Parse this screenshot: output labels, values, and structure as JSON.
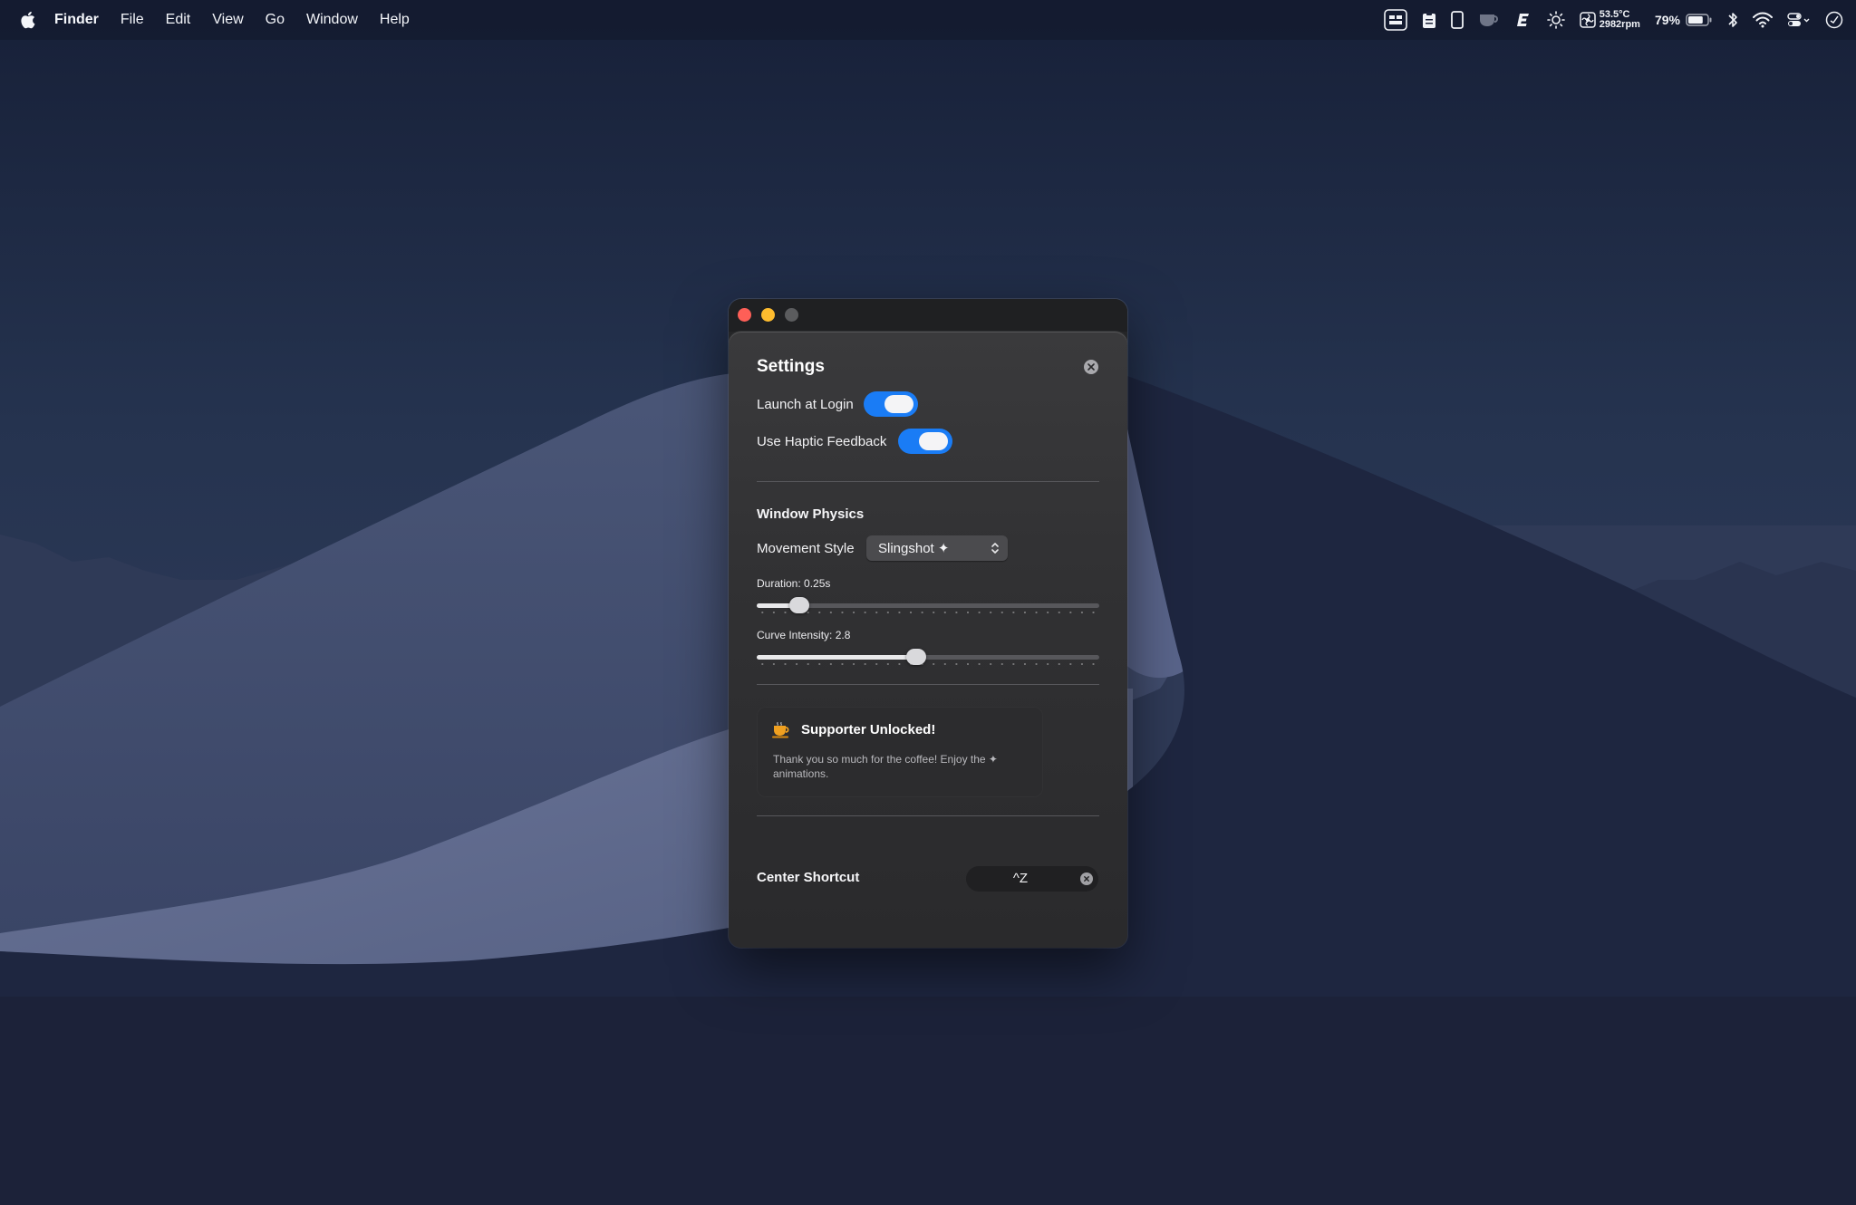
{
  "menubar": {
    "app_name": "Finder",
    "menus": [
      "File",
      "Edit",
      "View",
      "Go",
      "Window",
      "Help"
    ],
    "status": {
      "temperature": "53.5°C",
      "fan_speed": "2982rpm",
      "battery_percent": "79%",
      "battery_level": 0.79
    }
  },
  "window": {
    "title": "Settings",
    "general": {
      "launch_at_login": {
        "label": "Launch at Login",
        "enabled": true
      },
      "haptic_feedback": {
        "label": "Use Haptic Feedback",
        "enabled": true
      }
    },
    "physics": {
      "section_title": "Window Physics",
      "movement_style": {
        "label": "Movement Style",
        "value": "Slingshot ✦"
      },
      "duration": {
        "label": "Duration: 0.25s",
        "value": 0.25,
        "min": 0,
        "max": 2
      },
      "curve_intensity": {
        "label": "Curve Intensity: 2.8",
        "value": 2.8,
        "min": 0,
        "max": 6
      }
    },
    "supporter": {
      "heading": "Supporter Unlocked!",
      "body": "Thank you so much for the coffee! Enjoy the ✦ animations."
    },
    "shortcut": {
      "label": "Center Shortcut",
      "keys": "^Z"
    }
  },
  "colors": {
    "accent": "#1a7cf5",
    "traffic_close": "#fe5f57",
    "traffic_minimize": "#febc2e",
    "traffic_zoom": "#5b5c5e",
    "coffee": "#f0a020"
  }
}
